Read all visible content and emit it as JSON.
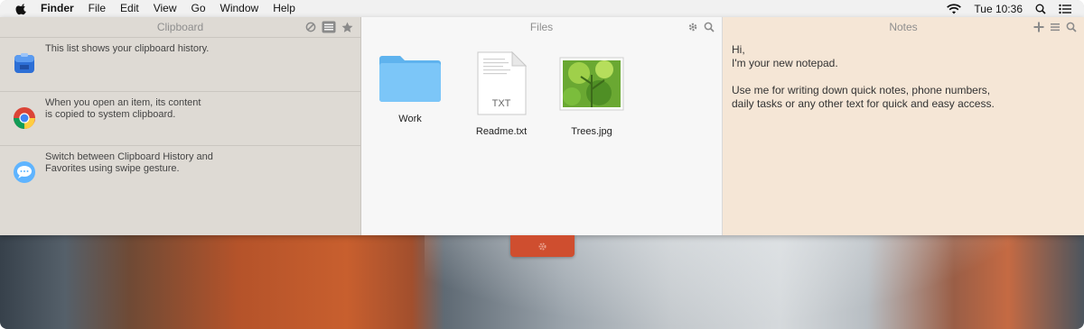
{
  "menubar": {
    "app_name": "Finder",
    "menus": [
      "File",
      "Edit",
      "View",
      "Go",
      "Window",
      "Help"
    ],
    "clock": "Tue 10:36"
  },
  "clipboard": {
    "title": "Clipboard",
    "items": [
      {
        "text": "This list shows your clipboard history.",
        "icon": "pastebot-icon"
      },
      {
        "text": "When you open an item, its content\nis copied to system clipboard.",
        "icon": "chrome-icon"
      },
      {
        "text": "Switch between Clipboard History and\nFavorites using swipe gesture.",
        "icon": "messages-icon"
      }
    ]
  },
  "files": {
    "title": "Files",
    "items": [
      {
        "label": "Work",
        "icon": "folder-icon"
      },
      {
        "label": "Readme.txt",
        "icon": "text-file-icon",
        "badge": "TXT"
      },
      {
        "label": "Trees.jpg",
        "icon": "image-thumbnail-icon"
      }
    ]
  },
  "notes": {
    "title": "Notes",
    "content": "Hi,\nI'm your new notepad.\n\nUse me for writing down quick notes, phone numbers,\ndaily tasks or any other text for quick and easy access."
  },
  "colors": {
    "clipboard_bg": "#dedad4",
    "files_bg": "#f7f7f7",
    "notes_bg": "#f5e6d6",
    "handle_accent": "#cf4e2f"
  }
}
